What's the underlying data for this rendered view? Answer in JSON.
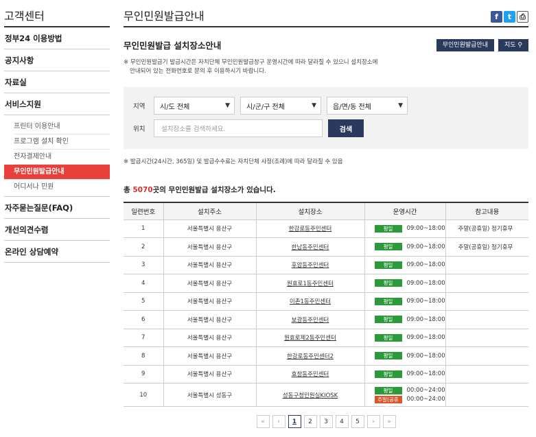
{
  "sidebar": {
    "title": "고객센터",
    "items_top": [
      {
        "label": "정부24 이용방법"
      },
      {
        "label": "공지사항"
      },
      {
        "label": "자료실"
      },
      {
        "label": "서비스지원"
      }
    ],
    "sub_items": [
      {
        "label": "프린터 이용안내"
      },
      {
        "label": "프로그램 설치 확인"
      },
      {
        "label": "전자결제안내"
      },
      {
        "label": "무인민원발급안내"
      },
      {
        "label": "어디서나 민원"
      }
    ],
    "items_bottom": [
      {
        "label": "자주묻는질문(FAQ)"
      },
      {
        "label": "개선의견수렴"
      },
      {
        "label": "온라인 상담예약"
      }
    ]
  },
  "header": {
    "title": "무인민원발급안내",
    "share": {
      "facebook": "f",
      "twitter": "t",
      "print": "⎙"
    }
  },
  "section": {
    "title": "무인민원발급 설치장소안내",
    "btn_guide": "무인민원발급안내",
    "btn_map": "지도 ⚲",
    "notice_line1": "※ 무인민원발급기 발급시간은 자치단체 무인민원발급창구 운영시간에 따라 달라질 수 있으니 설치장소에",
    "notice_line2": "안내되어 있는 전화번호로 문의 후 이용하시기 바랍니다."
  },
  "search": {
    "region_label": "지역",
    "sido": "시/도 전체",
    "sigungu": "시/군/구 전체",
    "eupmyeondong": "읍/면/동 전체",
    "location_label": "위치",
    "placeholder": "설치장소를 검색하세요.",
    "button": "검색"
  },
  "notice2": "※ 발급시간(24시간, 365일) 및 발급수수료는 자치단체 사정(조례)에 따라 달라질 수 있음",
  "total": {
    "prefix": "총 ",
    "count": "5070",
    "suffix": "곳의 무인민원발급 설치장소가 있습니다."
  },
  "table": {
    "headers": [
      "일련번호",
      "설치주소",
      "설치장소",
      "운영시간",
      "참고내용"
    ],
    "rows": [
      {
        "no": "1",
        "addr": "서울특별시 용산구",
        "place": "한강로동주민센터",
        "tag": "평일",
        "time": "09:00~18:00",
        "note": "주말(공휴일) 정기휴무"
      },
      {
        "no": "2",
        "addr": "서울특별시 용산구",
        "place": "한남동주민센터",
        "tag": "평일",
        "time": "09:00~18:00",
        "note": "주말(공휴일) 정기휴무"
      },
      {
        "no": "3",
        "addr": "서울특별시 용산구",
        "place": "후암동주민센터",
        "tag": "평일",
        "time": "09:00~18:00",
        "note": ""
      },
      {
        "no": "4",
        "addr": "서울특별시 용산구",
        "place": "원효로1동주민센터",
        "tag": "평일",
        "time": "09:00~18:00",
        "note": ""
      },
      {
        "no": "5",
        "addr": "서울특별시 용산구",
        "place": "이촌1동주민센터",
        "tag": "평일",
        "time": "09:00~18:00",
        "note": ""
      },
      {
        "no": "6",
        "addr": "서울특별시 용산구",
        "place": "보광동주민센터",
        "tag": "평일",
        "time": "09:00~18:00",
        "note": ""
      },
      {
        "no": "7",
        "addr": "서울특별시 용산구",
        "place": "원효로제2동주민센터",
        "tag": "평일",
        "time": "09:00~18:00",
        "note": ""
      },
      {
        "no": "8",
        "addr": "서울특별시 용산구",
        "place": "한강로동주민센터2",
        "tag": "평일",
        "time": "09:00~18:00",
        "note": ""
      },
      {
        "no": "9",
        "addr": "서울특별시 용산구",
        "place": "효창동주민센터",
        "tag": "평일",
        "time": "09:00~18:00",
        "note": ""
      }
    ],
    "row10": {
      "no": "10",
      "addr": "서울특별시 성동구",
      "place": "성동구청민원실KIOSK",
      "tag1": "평일",
      "time1": "00:00~24:00",
      "tag2": "주말(공휴일)",
      "time2": "00:00~24:00",
      "note": ""
    }
  },
  "pager": {
    "first": "«",
    "prev": "‹",
    "pages": [
      "1",
      "2",
      "3",
      "4",
      "5"
    ],
    "current": "1",
    "next": "›",
    "last": "»"
  }
}
